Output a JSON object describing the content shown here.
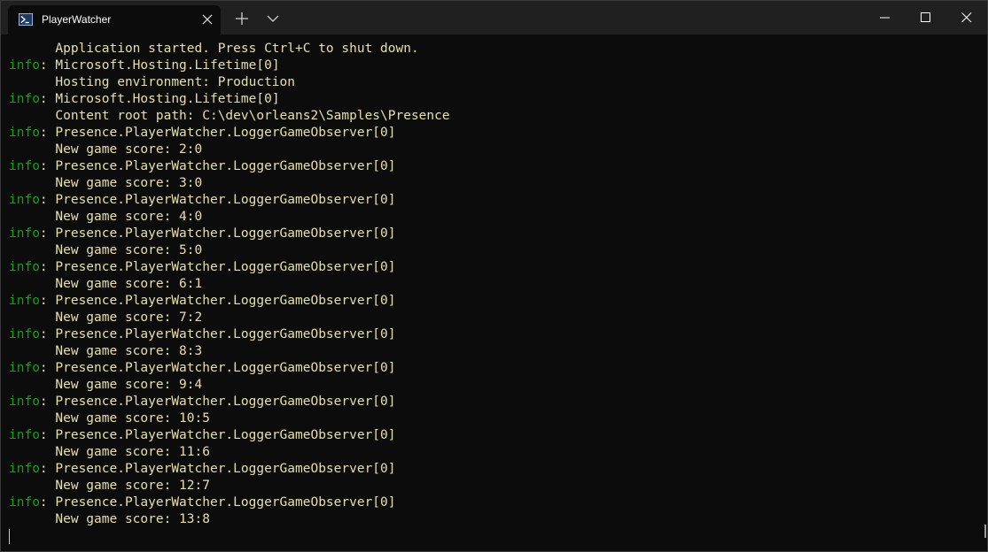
{
  "window": {
    "tab_title": "PlayerWatcher",
    "icons": {
      "tab": "powershell-icon",
      "tab_close": "close-icon",
      "new_tab": "plus-icon",
      "dropdown": "chevron-down-icon",
      "minimize": "minimize-icon",
      "maximize": "maximize-icon",
      "close": "close-icon"
    }
  },
  "colors": {
    "background": "#0c0c0c",
    "titlebar": "#202020",
    "level_prefix": "#13a10e",
    "message_text": "#e5e0a8"
  },
  "terminal": {
    "lines": [
      {
        "prefix": "",
        "text": "      Application started. Press Ctrl+C to shut down."
      },
      {
        "prefix": "info",
        "text": ": Microsoft.Hosting.Lifetime[0]"
      },
      {
        "prefix": "",
        "text": "      Hosting environment: Production"
      },
      {
        "prefix": "info",
        "text": ": Microsoft.Hosting.Lifetime[0]"
      },
      {
        "prefix": "",
        "text": "      Content root path: C:\\dev\\orleans2\\Samples\\Presence"
      },
      {
        "prefix": "info",
        "text": ": Presence.PlayerWatcher.LoggerGameObserver[0]"
      },
      {
        "prefix": "",
        "text": "      New game score: 2:0"
      },
      {
        "prefix": "info",
        "text": ": Presence.PlayerWatcher.LoggerGameObserver[0]"
      },
      {
        "prefix": "",
        "text": "      New game score: 3:0"
      },
      {
        "prefix": "info",
        "text": ": Presence.PlayerWatcher.LoggerGameObserver[0]"
      },
      {
        "prefix": "",
        "text": "      New game score: 4:0"
      },
      {
        "prefix": "info",
        "text": ": Presence.PlayerWatcher.LoggerGameObserver[0]"
      },
      {
        "prefix": "",
        "text": "      New game score: 5:0"
      },
      {
        "prefix": "info",
        "text": ": Presence.PlayerWatcher.LoggerGameObserver[0]"
      },
      {
        "prefix": "",
        "text": "      New game score: 6:1"
      },
      {
        "prefix": "info",
        "text": ": Presence.PlayerWatcher.LoggerGameObserver[0]"
      },
      {
        "prefix": "",
        "text": "      New game score: 7:2"
      },
      {
        "prefix": "info",
        "text": ": Presence.PlayerWatcher.LoggerGameObserver[0]"
      },
      {
        "prefix": "",
        "text": "      New game score: 8:3"
      },
      {
        "prefix": "info",
        "text": ": Presence.PlayerWatcher.LoggerGameObserver[0]"
      },
      {
        "prefix": "",
        "text": "      New game score: 9:4"
      },
      {
        "prefix": "info",
        "text": ": Presence.PlayerWatcher.LoggerGameObserver[0]"
      },
      {
        "prefix": "",
        "text": "      New game score: 10:5"
      },
      {
        "prefix": "info",
        "text": ": Presence.PlayerWatcher.LoggerGameObserver[0]"
      },
      {
        "prefix": "",
        "text": "      New game score: 11:6"
      },
      {
        "prefix": "info",
        "text": ": Presence.PlayerWatcher.LoggerGameObserver[0]"
      },
      {
        "prefix": "",
        "text": "      New game score: 12:7"
      },
      {
        "prefix": "info",
        "text": ": Presence.PlayerWatcher.LoggerGameObserver[0]"
      },
      {
        "prefix": "",
        "text": "      New game score: 13:8"
      }
    ]
  }
}
